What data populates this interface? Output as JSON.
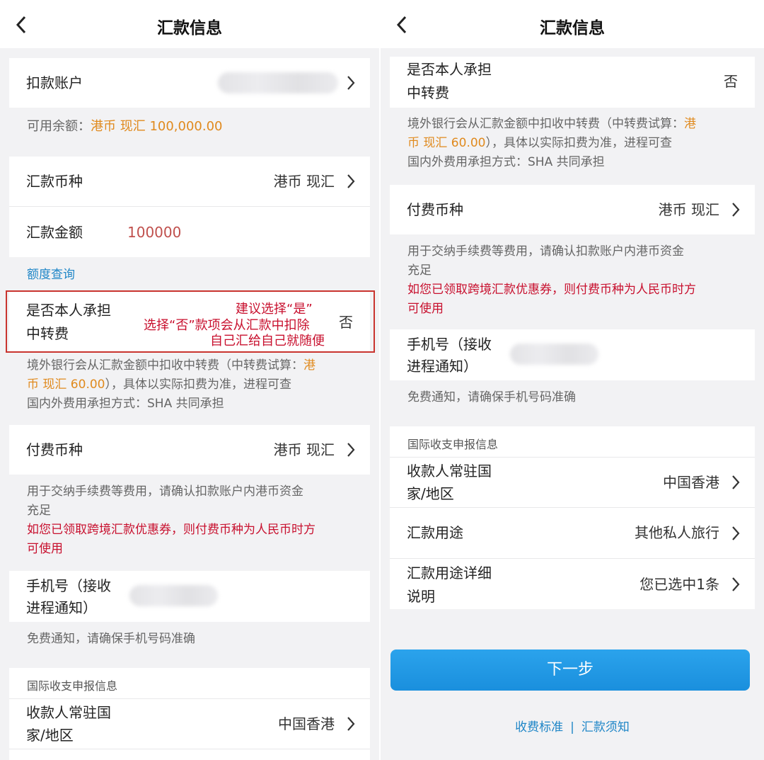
{
  "colors": {
    "accent": "#1a8fdd",
    "orange": "#e08a1e",
    "red": "#c8102e",
    "link": "#1f86c7"
  },
  "header": {
    "title": "汇款信息",
    "back_icon": "chevron-left-icon"
  },
  "left": {
    "debit_account": {
      "label": "扣款账户"
    },
    "balance": {
      "prefix": "可用余额：",
      "value": "港币 现汇 100,000.00"
    },
    "currency": {
      "label": "汇款币种",
      "value": "港币 现汇"
    },
    "amount": {
      "label": "汇款金额",
      "value": "100000"
    },
    "quota_link": "额度查询",
    "bear_fee": {
      "label_line1": "是否本人承担",
      "label_line2": "中转费",
      "value": "否"
    },
    "annotation": {
      "line1": "建议选择“是”",
      "line2": "选择“否”款项会从汇款中扣除",
      "line3": "自己汇给自己就随便"
    },
    "fee_note": {
      "line1_pre": "境外银行会从汇款金额中扣收中转费（中转费试算：",
      "line1_hl": "港",
      "line2_hl": "币 现汇 60.00",
      "line2_post": "），具体以实际扣费为准，进程可查",
      "line3": "国内外费用承担方式：SHA 共同承担"
    },
    "pay_currency": {
      "label": "付费币种",
      "value": "港币 现汇"
    },
    "pay_note": {
      "line1": "用于交纳手续费等费用，请确认扣款账户内港币资金",
      "line2": "充足",
      "line3": "如您已领取跨境汇款优惠券，则付费币种为人民币时方",
      "line4": "可使用"
    },
    "phone": {
      "label_line1": "手机号（接收",
      "label_line2": "进程通知）"
    },
    "phone_note": "免费通知，请确保手机号码准确",
    "section_title": "国际收支申报信息",
    "country": {
      "label_line1": "收款人常驻国",
      "label_line2": "家/地区",
      "value": "中国香港"
    }
  },
  "right": {
    "bear_fee": {
      "label_line1": "是否本人承担",
      "label_line2": "中转费",
      "value": "否"
    },
    "fee_note": {
      "line1_pre": "境外银行会从汇款金额中扣收中转费（中转费试算：",
      "line1_hl": "港",
      "line2_hl": "币 现汇 60.00",
      "line2_post": "），具体以实际扣费为准，进程可查",
      "line3": "国内外费用承担方式：SHA 共同承担"
    },
    "pay_currency": {
      "label": "付费币种",
      "value": "港币 现汇"
    },
    "pay_note": {
      "line1": "用于交纳手续费等费用，请确认扣款账户内港币资金",
      "line2": "充足",
      "line3": "如您已领取跨境汇款优惠券，则付费币种为人民币时方",
      "line4": "可使用"
    },
    "phone": {
      "label_line1": "手机号（接收",
      "label_line2": "进程通知）"
    },
    "phone_note": "免费通知，请确保手机号码准确",
    "section_title": "国际收支申报信息",
    "country": {
      "label_line1": "收款人常驻国",
      "label_line2": "家/地区",
      "value": "中国香港"
    },
    "purpose": {
      "label": "汇款用途",
      "value": "其他私人旅行"
    },
    "purpose_detail": {
      "label_line1": "汇款用途详细",
      "label_line2": "说明",
      "value": "您已选中1条"
    },
    "next_button": "下一步",
    "links": {
      "fee_standard": "收费标准",
      "separator": "|",
      "notice": "汇款须知"
    }
  }
}
